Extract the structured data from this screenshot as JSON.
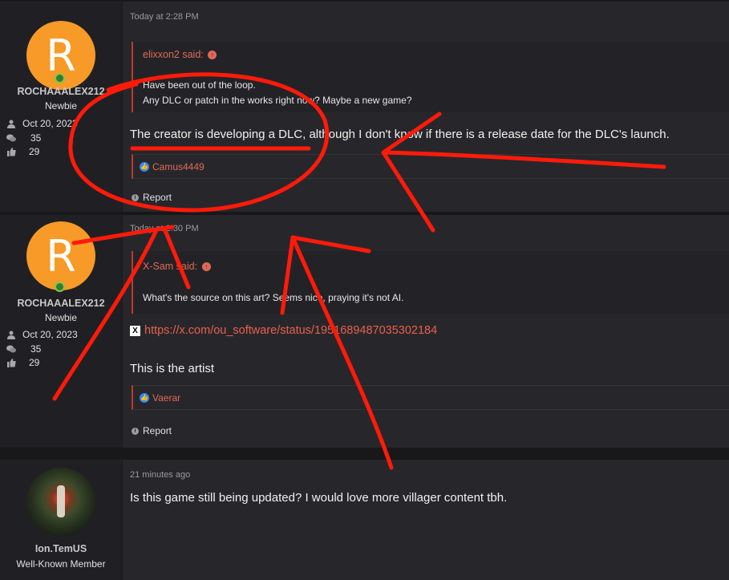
{
  "posts": [
    {
      "avatar_letter": "R",
      "username": "ROCHAAALEX212",
      "user_title": "Newbie",
      "joined": "Oct 20, 2023",
      "messages": "35",
      "reactions": "29",
      "timestamp": "Today at 2:28 PM",
      "quote_author": "elixxon2 said:",
      "quote_lines": [
        "Have been out of the loop.",
        "Any DLC or patch in the works right now? Maybe a new game?"
      ],
      "body": "The creator is developing a DLC, although I don't know if there is a release date for the DLC's launch.",
      "reactor": "Camus4449",
      "report": "Report"
    },
    {
      "avatar_letter": "R",
      "username": "ROCHAAALEX212",
      "user_title": "Newbie",
      "joined": "Oct 20, 2023",
      "messages": "35",
      "reactions": "29",
      "timestamp": "Today at 2:30 PM",
      "quote_author": "X-Sam said:",
      "quote_lines": [
        "What's the source on this art? Seems nice, praying it's not AI."
      ],
      "link": "https://x.com/ou_software/status/1951689487035302184",
      "body": "This is the artist",
      "reactor": "Vaerar",
      "report": "Report"
    },
    {
      "username": "Ion.TemUS",
      "user_title": "Well-Known Member",
      "timestamp": "21 minutes ago",
      "body": "Is this game still being updated? I would love more villager content tbh."
    }
  ],
  "icons": {
    "joined": "user-icon",
    "messages": "chat-bubbles-icon",
    "reactions": "thumbs-up-icon",
    "quote_arrow": "arrow-up-circle-icon",
    "like": "like-icon",
    "report": "info-icon",
    "x_logo": "x-logo-icon"
  },
  "colors": {
    "accent": "#e8604c",
    "avatar": "#f79a27",
    "annotation": "#ff1a0a"
  }
}
